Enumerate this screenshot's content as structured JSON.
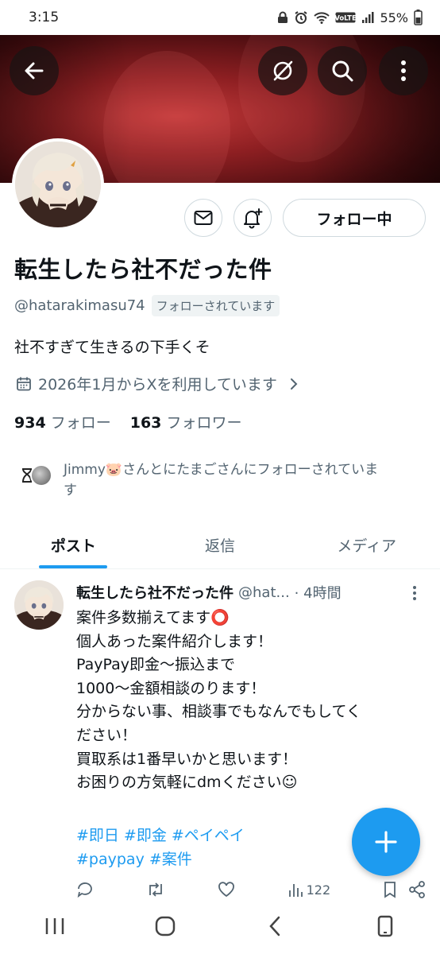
{
  "status_bar": {
    "time": "3:15",
    "battery": "55%"
  },
  "profile": {
    "display_name": "転生したら社不だった件",
    "handle": "@hatarakimasu74",
    "follows_you": "フォローされています",
    "bio": "社不すぎて生きるの下手くそ",
    "joined": "2026年1月からXを利用しています",
    "following_count": "934",
    "following_label": "フォロー",
    "followers_count": "163",
    "followers_label": "フォロワー",
    "followed_by_line1": "Jimmy🐷さんとにたまごさんにフォローされていま",
    "followed_by_line2": "す"
  },
  "buttons": {
    "follow_label": "フォロー中"
  },
  "tabs": [
    {
      "label": "ポスト",
      "active": true
    },
    {
      "label": "返信",
      "active": false
    },
    {
      "label": "メディア",
      "active": false
    }
  ],
  "post": {
    "name": "転生したら社不だった件",
    "handle": "@hat...",
    "time": "· 4時間",
    "lines": [
      "案件多数揃えてます⭕",
      "個人あった案件紹介します！",
      "PayPay即金〜振込まで",
      "1000〜金額相談のります！",
      "分からない事、相談事でもなんでもしてく",
      "ださい！",
      "買取系は1番早いかと思います！",
      "お困りの方気軽にdmください☺"
    ],
    "hashtags_line1": [
      "#即日",
      "#即金",
      "#ペイペイ"
    ],
    "hashtags_line2": [
      "#paypay",
      "#案件"
    ],
    "views": "122"
  },
  "colors": {
    "accent": "#1d9bf0",
    "banner": "#8e1f22",
    "text": "#0f1419",
    "muted": "#536471"
  },
  "icons": [
    "back-arrow-icon",
    "grok-icon",
    "search-icon",
    "more-vertical-icon",
    "mail-icon",
    "bell-plus-icon",
    "calendar-icon",
    "chevron-right-icon",
    "plus-icon"
  ]
}
